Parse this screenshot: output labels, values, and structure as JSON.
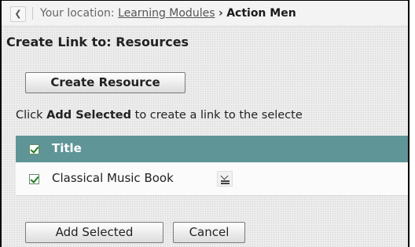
{
  "breadcrumb": {
    "prefix": "Your location:",
    "link": "Learning Modules",
    "arrow": "›",
    "current": "Action Men"
  },
  "page": {
    "title": "Create Link to: Resources"
  },
  "toolbar": {
    "create_resource_label": "Create Resource"
  },
  "instruction": {
    "before": "Click ",
    "bold": "Add Selected",
    "after": " to create a link to the selecte"
  },
  "table": {
    "header_label": "Title",
    "rows": [
      {
        "title": "Classical Music Book",
        "checked": true
      }
    ]
  },
  "actions": {
    "add_selected_label": "Add Selected",
    "cancel_label": "Cancel"
  },
  "colors": {
    "header_bg": "#5f9596"
  }
}
